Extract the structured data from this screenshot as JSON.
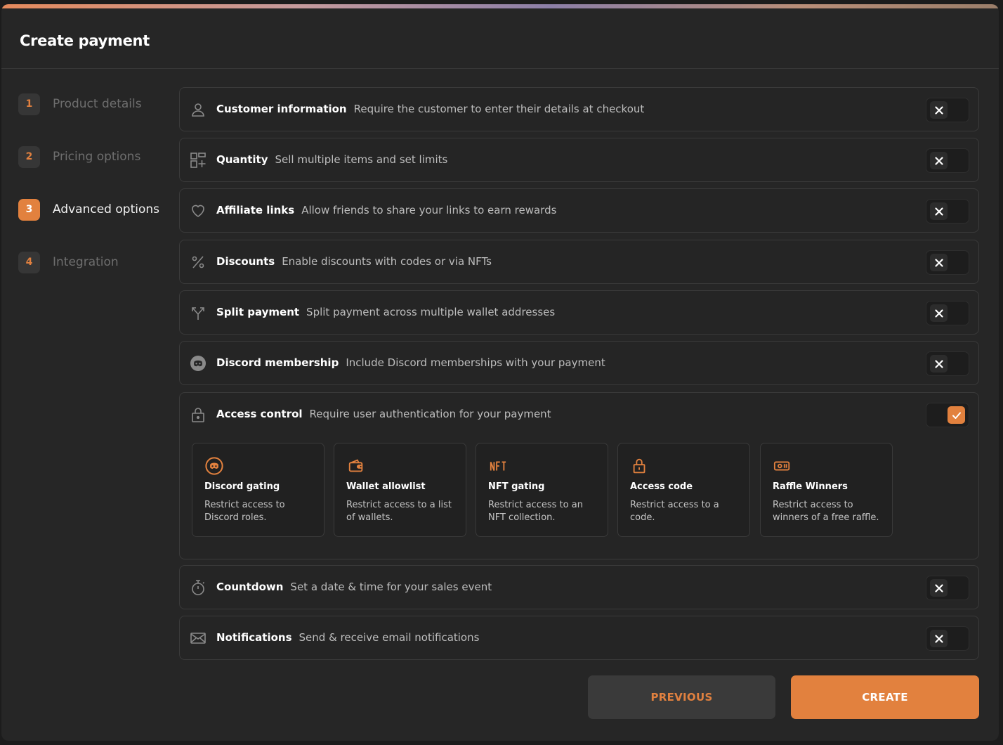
{
  "title": "Create payment",
  "steps": [
    {
      "num": "1",
      "label": "Product details"
    },
    {
      "num": "2",
      "label": "Pricing options"
    },
    {
      "num": "3",
      "label": "Advanced options"
    },
    {
      "num": "4",
      "label": "Integration"
    }
  ],
  "active_step": "3",
  "options": [
    {
      "icon": "user-icon",
      "title": "Customer information",
      "desc": "Require the customer to enter their details at checkout",
      "enabled": false
    },
    {
      "icon": "quantity-icon",
      "title": "Quantity",
      "desc": "Sell multiple items and set limits",
      "enabled": false
    },
    {
      "icon": "heart-icon",
      "title": "Affiliate links",
      "desc": "Allow friends to share your links to earn rewards",
      "enabled": false
    },
    {
      "icon": "percent-icon",
      "title": "Discounts",
      "desc": "Enable discounts with codes or via NFTs",
      "enabled": false
    },
    {
      "icon": "split-icon",
      "title": "Split payment",
      "desc": "Split payment across multiple wallet addresses",
      "enabled": false
    },
    {
      "icon": "discord-icon",
      "title": "Discord membership",
      "desc": "Include Discord memberships with your payment",
      "enabled": false
    },
    {
      "icon": "lock-icon",
      "title": "Access control",
      "desc": "Require user authentication for your payment",
      "enabled": true
    },
    {
      "icon": "stopwatch-icon",
      "title": "Countdown",
      "desc": "Set a date & time for your sales event",
      "enabled": false
    },
    {
      "icon": "mail-icon",
      "title": "Notifications",
      "desc": "Send & receive email notifications",
      "enabled": false
    }
  ],
  "access_cards": [
    {
      "icon": "discord-icon",
      "title": "Discord gating",
      "desc": "Restrict access to Discord roles."
    },
    {
      "icon": "wallet-icon",
      "title": "Wallet allowlist",
      "desc": "Restrict access to a list of wallets."
    },
    {
      "icon": "nft-icon",
      "title": "NFT gating",
      "desc": "Restrict access to an NFT collection."
    },
    {
      "icon": "lock-icon",
      "title": "Access code",
      "desc": "Restrict access to a code."
    },
    {
      "icon": "ticket-icon",
      "title": "Raffle Winners",
      "desc": "Restrict access to winners of a free raffle."
    }
  ],
  "buttons": {
    "previous": "PREVIOUS",
    "create": "CREATE"
  },
  "colors": {
    "accent": "#e2813e",
    "background": "#262626",
    "border": "#3a3a3a"
  }
}
